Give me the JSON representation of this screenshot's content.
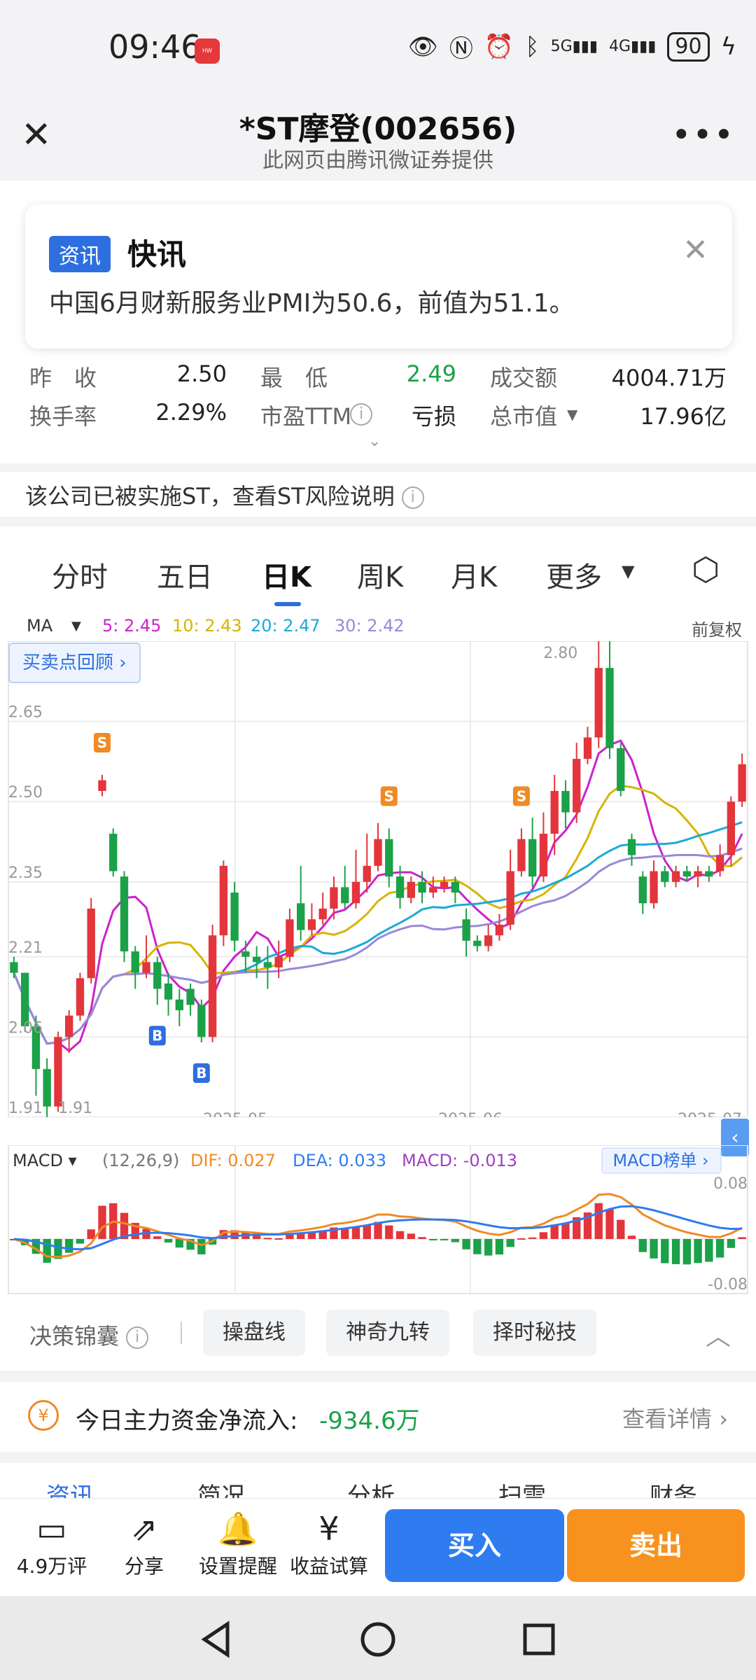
{
  "status_bar": {
    "time": "09:46",
    "battery": "90"
  },
  "header": {
    "title": "*ST摩登(002656)",
    "subtitle": "此网页由腾讯微证券提供"
  },
  "news_card": {
    "tag": "资讯",
    "heading": "快讯",
    "body": "中国6月财新服务业PMI为50.6，前值为51.1。"
  },
  "quote": {
    "row1": [
      {
        "label": "昨　收",
        "value": "2.50"
      },
      {
        "label": "最　低",
        "value": "2.49"
      },
      {
        "label": "成交额",
        "value": "4004.71万"
      }
    ],
    "row2": [
      {
        "label": "换手率",
        "value": "2.29%"
      },
      {
        "label": "市盈TTM",
        "value": "亏损"
      },
      {
        "label": "总市值",
        "value": "17.96亿"
      }
    ]
  },
  "st_notice": "该公司已被实施ST，查看ST风险说明",
  "period_tabs": [
    "分时",
    "五日",
    "日K",
    "周K",
    "月K",
    "更多"
  ],
  "active_tab": "日K",
  "ma_legend": {
    "name": "MA",
    "ma5": "5: 2.45",
    "ma10": "10: 2.43",
    "ma20": "20: 2.47",
    "ma30": "30: 2.42",
    "adjust": "前复权"
  },
  "review_button": "买卖点回顾",
  "colors": {
    "up": "#e3353b",
    "down": "#1ba148",
    "ma5": "#cc22cc",
    "ma10": "#d8b400",
    "ma20": "#1aaad8",
    "ma30": "#9a88d8",
    "accent": "#2e6fe0",
    "sell": "#f7921e"
  },
  "chart_data": [
    {
      "type": "candlestick",
      "y_ticks": [
        "2.65",
        "2.50",
        "2.35",
        "2.21",
        "2.06",
        "1.91"
      ],
      "ylim": [
        1.91,
        2.8
      ],
      "x_ticks": [
        "2025-05",
        "2025-06",
        "2025-07"
      ],
      "high_label": "2.80",
      "low_label": "1.91",
      "signals": [
        "S",
        "B",
        "B",
        "B",
        "S",
        "S"
      ],
      "candles": [
        [
          2.2,
          2.18,
          2.21,
          2.17
        ],
        [
          2.18,
          2.08,
          2.18,
          2.07
        ],
        [
          2.08,
          2.0,
          2.1,
          1.95
        ],
        [
          2.0,
          1.93,
          2.02,
          1.91
        ],
        [
          1.93,
          2.06,
          2.07,
          1.92
        ],
        [
          2.06,
          2.1,
          2.11,
          2.03
        ],
        [
          2.1,
          2.17,
          2.18,
          2.09
        ],
        [
          2.17,
          2.3,
          2.32,
          2.16
        ],
        [
          2.52,
          2.54,
          2.55,
          2.51
        ],
        [
          2.44,
          2.37,
          2.45,
          2.36
        ],
        [
          2.36,
          2.22,
          2.37,
          2.2
        ],
        [
          2.22,
          2.18,
          2.23,
          2.15
        ],
        [
          2.18,
          2.2,
          2.25,
          2.17
        ],
        [
          2.2,
          2.15,
          2.21,
          2.12
        ],
        [
          2.16,
          2.13,
          2.18,
          2.1
        ],
        [
          2.13,
          2.11,
          2.15,
          2.08
        ],
        [
          2.15,
          2.12,
          2.16,
          2.1
        ],
        [
          2.12,
          2.06,
          2.13,
          2.05
        ],
        [
          2.06,
          2.25,
          2.27,
          2.05
        ],
        [
          2.25,
          2.38,
          2.39,
          2.23
        ],
        [
          2.33,
          2.24,
          2.35,
          2.22
        ],
        [
          2.22,
          2.21,
          2.24,
          2.18
        ],
        [
          2.21,
          2.2,
          2.23,
          2.17
        ],
        [
          2.2,
          2.19,
          2.23,
          2.15
        ],
        [
          2.19,
          2.21,
          2.24,
          2.17
        ],
        [
          2.21,
          2.28,
          2.3,
          2.2
        ],
        [
          2.31,
          2.26,
          2.38,
          2.24
        ],
        [
          2.26,
          2.28,
          2.31,
          2.25
        ],
        [
          2.28,
          2.3,
          2.33,
          2.27
        ],
        [
          2.3,
          2.34,
          2.36,
          2.28
        ],
        [
          2.34,
          2.31,
          2.38,
          2.3
        ],
        [
          2.31,
          2.35,
          2.41,
          2.3
        ],
        [
          2.35,
          2.38,
          2.44,
          2.33
        ],
        [
          2.38,
          2.43,
          2.46,
          2.37
        ],
        [
          2.43,
          2.36,
          2.45,
          2.34
        ],
        [
          2.36,
          2.32,
          2.38,
          2.3
        ],
        [
          2.32,
          2.35,
          2.36,
          2.31
        ],
        [
          2.35,
          2.33,
          2.37,
          2.31
        ],
        [
          2.33,
          2.34,
          2.36,
          2.32
        ],
        [
          2.34,
          2.35,
          2.36,
          2.33
        ],
        [
          2.35,
          2.33,
          2.36,
          2.31
        ],
        [
          2.28,
          2.24,
          2.3,
          2.21
        ],
        [
          2.24,
          2.23,
          2.25,
          2.22
        ],
        [
          2.23,
          2.25,
          2.27,
          2.22
        ],
        [
          2.25,
          2.27,
          2.29,
          2.24
        ],
        [
          2.27,
          2.37,
          2.41,
          2.26
        ],
        [
          2.37,
          2.43,
          2.45,
          2.36
        ],
        [
          2.43,
          2.36,
          2.47,
          2.34
        ],
        [
          2.36,
          2.44,
          2.48,
          2.35
        ],
        [
          2.44,
          2.52,
          2.55,
          2.4
        ],
        [
          2.52,
          2.48,
          2.54,
          2.45
        ],
        [
          2.48,
          2.58,
          2.61,
          2.46
        ],
        [
          2.58,
          2.62,
          2.64,
          2.57
        ],
        [
          2.62,
          2.75,
          2.8,
          2.6
        ],
        [
          2.75,
          2.6,
          2.8,
          2.58
        ],
        [
          2.6,
          2.52,
          2.61,
          2.51
        ],
        [
          2.43,
          2.4,
          2.44,
          2.38
        ],
        [
          2.36,
          2.31,
          2.37,
          2.29
        ],
        [
          2.31,
          2.37,
          2.39,
          2.3
        ],
        [
          2.37,
          2.35,
          2.38,
          2.34
        ],
        [
          2.35,
          2.37,
          2.38,
          2.34
        ],
        [
          2.37,
          2.36,
          2.38,
          2.35
        ],
        [
          2.36,
          2.37,
          2.38,
          2.34
        ],
        [
          2.37,
          2.36,
          2.38,
          2.35
        ],
        [
          2.37,
          2.4,
          2.42,
          2.36
        ],
        [
          2.4,
          2.5,
          2.51,
          2.38
        ],
        [
          2.5,
          2.57,
          2.59,
          2.49
        ]
      ]
    },
    {
      "type": "macd",
      "label": "MACD",
      "params": "(12,26,9)",
      "dif": "DIF: 0.027",
      "dea": "DEA: 0.033",
      "macd": "MACD: -0.013",
      "rank_button": "MACD榜单",
      "y_ticks": [
        "0.08",
        "-0.08"
      ]
    }
  ],
  "decision": {
    "label": "决策锦囊",
    "chips": [
      "操盘线",
      "神奇九转",
      "择时秘技"
    ]
  },
  "fund_flow": {
    "icon": "¥",
    "label": "今日主力资金净流入:",
    "value": "-934.6万",
    "link": "查看详情"
  },
  "bottom_tabs": [
    "资讯",
    "简况",
    "分析",
    "扫雷",
    "财务"
  ],
  "actions": [
    {
      "label": "4.9万评",
      "icon": "comment-icon"
    },
    {
      "label": "分享",
      "icon": "share-icon"
    },
    {
      "label": "设置提醒",
      "icon": "bell-icon"
    },
    {
      "label": "收益试算",
      "icon": "yuan-icon"
    }
  ],
  "buy_label": "买入",
  "sell_label": "卖出"
}
